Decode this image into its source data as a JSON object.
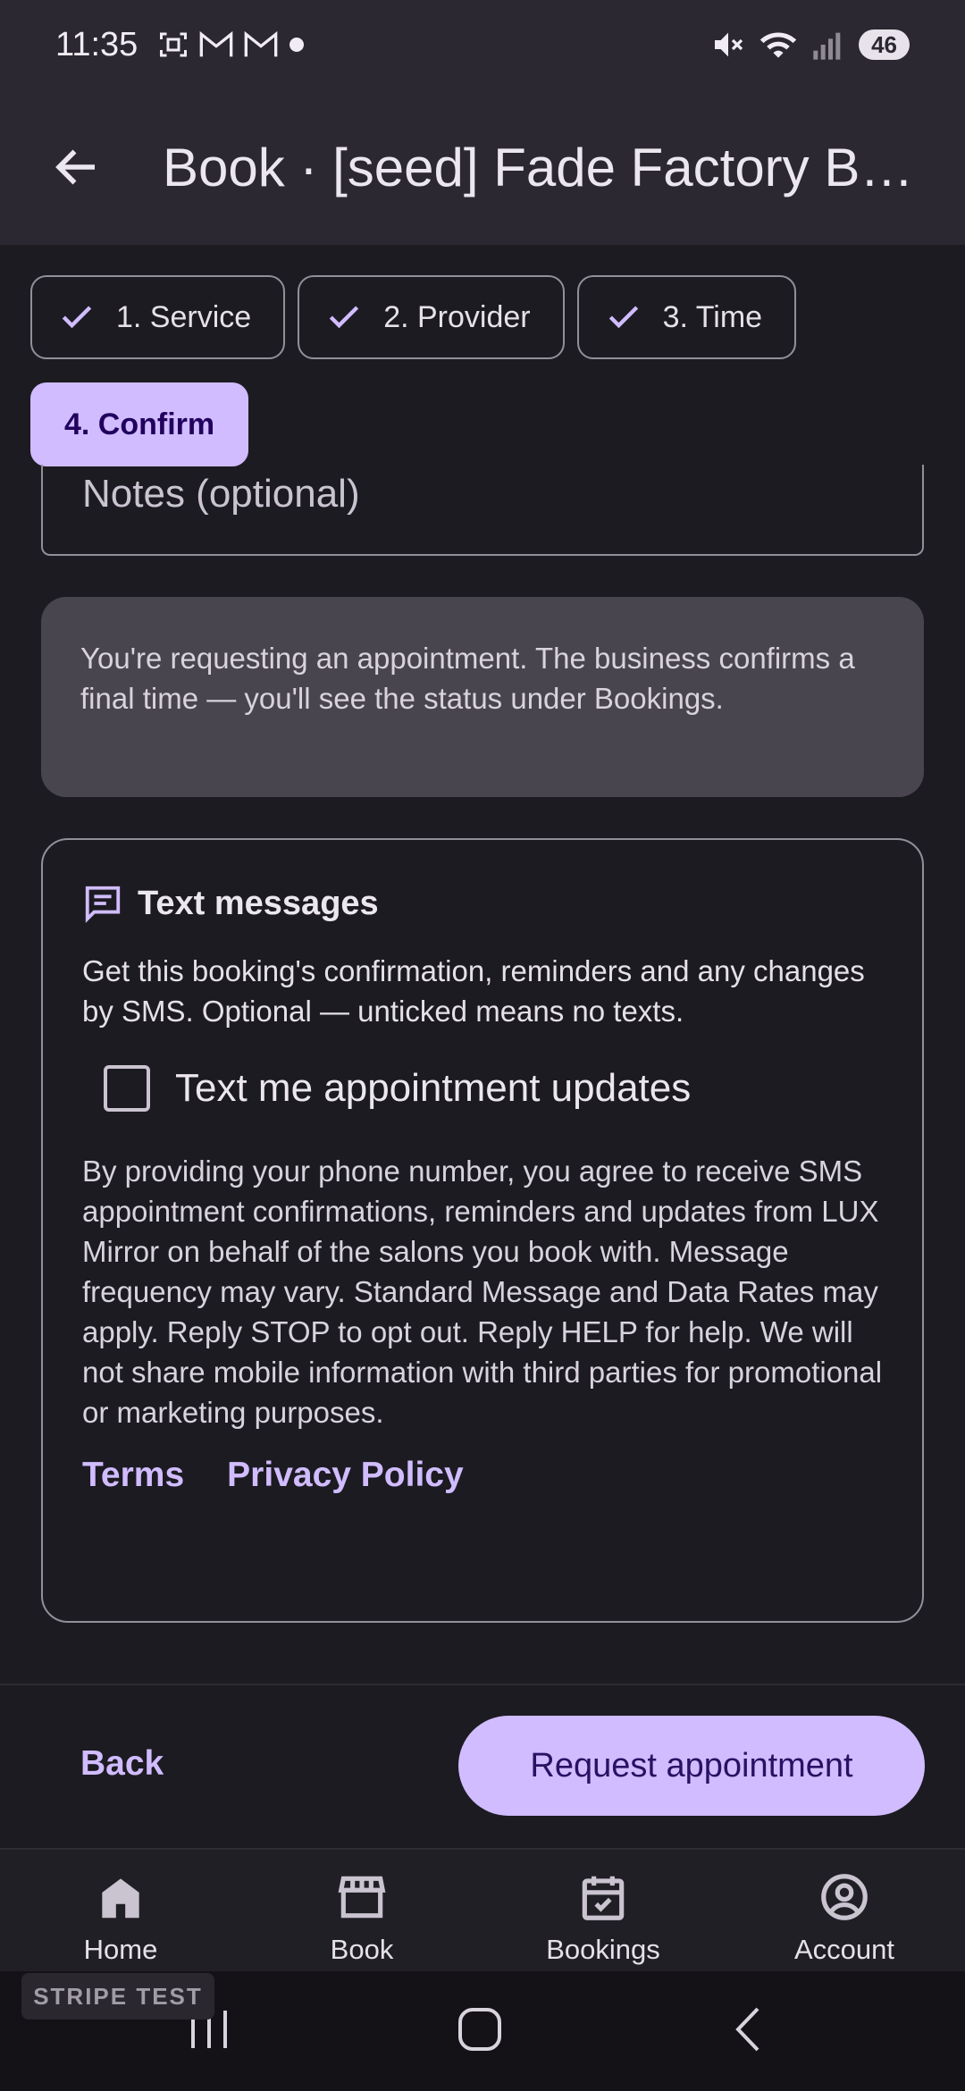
{
  "status_bar": {
    "time": "11:35",
    "battery": "46",
    "icons": [
      "screenshot-icon",
      "gmail-icon",
      "gmail-icon",
      "dot-icon",
      "mute-icon",
      "wifi-icon",
      "signal-icon"
    ]
  },
  "app_bar": {
    "title": "Book · [seed] Fade Factory Bar..."
  },
  "steps": [
    {
      "label": "1. Service",
      "done": true
    },
    {
      "label": "2. Provider",
      "done": true
    },
    {
      "label": "3. Time",
      "done": true
    },
    {
      "label": "4. Confirm",
      "done": false,
      "selected": true
    }
  ],
  "notes": {
    "placeholder": "Notes (optional)"
  },
  "info": {
    "text": "You're requesting an appointment. The business confirms a final time — you'll see the status under Bookings."
  },
  "sms": {
    "title": "Text messages",
    "description": "Get this booking's confirmation, reminders and any changes by SMS. Optional — unticked means no texts.",
    "checkbox_label": "Text me appointment updates",
    "checked": false,
    "legal": "By providing your phone number, you agree to receive SMS appointment confirmations, reminders and updates from LUX Mirror on behalf of the salons you book with. Message frequency may vary. Standard Message and Data Rates may apply. Reply STOP to opt out. Reply HELP for help. We will not share mobile information with third parties for promotional or marketing purposes.",
    "terms_link": "Terms",
    "privacy_link": "Privacy Policy"
  },
  "actions": {
    "back": "Back",
    "request": "Request appointment"
  },
  "bottom_nav": [
    {
      "label": "Home",
      "icon": "home-icon"
    },
    {
      "label": "Book",
      "icon": "storefront-icon"
    },
    {
      "label": "Bookings",
      "icon": "calendar-check-icon"
    },
    {
      "label": "Account",
      "icon": "account-circle-icon"
    }
  ],
  "badge": "STRIPE TEST",
  "colors": {
    "accent": "#d0bcff",
    "background": "#1c1b21",
    "surface": "#2b2831"
  }
}
